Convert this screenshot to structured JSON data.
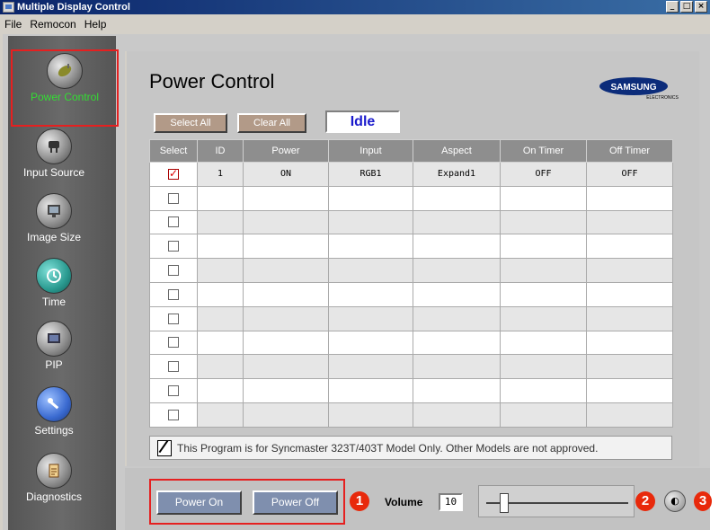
{
  "window": {
    "title": "Multiple Display Control"
  },
  "menu": {
    "items": [
      "File",
      "Remocon",
      "Help"
    ]
  },
  "sidebar": {
    "items": [
      {
        "label": "Power Control",
        "icon": "power-plug-icon",
        "active": true
      },
      {
        "label": "Input Source",
        "icon": "input-cable-icon"
      },
      {
        "label": "Image Size",
        "icon": "monitor-icon"
      },
      {
        "label": "Time",
        "icon": "clock-icon"
      },
      {
        "label": "PIP",
        "icon": "pip-screen-icon"
      },
      {
        "label": "Settings",
        "icon": "wrench-icon"
      },
      {
        "label": "Diagnostics",
        "icon": "clipboard-icon"
      }
    ]
  },
  "main": {
    "title": "Power Control",
    "brand": {
      "name": "SAMSUNG",
      "sub": "ELECTRONICS"
    },
    "buttons": {
      "select_all": "Select All",
      "clear_all": "Clear All"
    },
    "status": "Idle",
    "table": {
      "columns": [
        "Select",
        "ID",
        "Power",
        "Input",
        "Aspect",
        "On Timer",
        "Off Timer"
      ],
      "rows": [
        {
          "checked": true,
          "id": "1",
          "power": "ON",
          "input": "RGB1",
          "aspect": "Expand1",
          "on_timer": "OFF",
          "off_timer": "OFF"
        },
        {
          "checked": false,
          "id": "",
          "power": "",
          "input": "",
          "aspect": "",
          "on_timer": "",
          "off_timer": ""
        },
        {
          "checked": false,
          "id": "",
          "power": "",
          "input": "",
          "aspect": "",
          "on_timer": "",
          "off_timer": ""
        },
        {
          "checked": false,
          "id": "",
          "power": "",
          "input": "",
          "aspect": "",
          "on_timer": "",
          "off_timer": ""
        },
        {
          "checked": false,
          "id": "",
          "power": "",
          "input": "",
          "aspect": "",
          "on_timer": "",
          "off_timer": ""
        },
        {
          "checked": false,
          "id": "",
          "power": "",
          "input": "",
          "aspect": "",
          "on_timer": "",
          "off_timer": ""
        },
        {
          "checked": false,
          "id": "",
          "power": "",
          "input": "",
          "aspect": "",
          "on_timer": "",
          "off_timer": ""
        },
        {
          "checked": false,
          "id": "",
          "power": "",
          "input": "",
          "aspect": "",
          "on_timer": "",
          "off_timer": ""
        },
        {
          "checked": false,
          "id": "",
          "power": "",
          "input": "",
          "aspect": "",
          "on_timer": "",
          "off_timer": ""
        },
        {
          "checked": false,
          "id": "",
          "power": "",
          "input": "",
          "aspect": "",
          "on_timer": "",
          "off_timer": ""
        },
        {
          "checked": false,
          "id": "",
          "power": "",
          "input": "",
          "aspect": "",
          "on_timer": "",
          "off_timer": ""
        }
      ]
    },
    "notice": "This Program is for Syncmaster 323T/403T Model Only. Other Models are not approved."
  },
  "footer": {
    "power_on": "Power On",
    "power_off": "Power Off",
    "volume_label": "Volume",
    "volume_value": "10",
    "volume_level": 0.1,
    "badges": [
      "1",
      "2",
      "3"
    ]
  },
  "colors": {
    "highlight": "#e52020",
    "active_label": "#33dd33",
    "status_text": "#1a1acc"
  }
}
